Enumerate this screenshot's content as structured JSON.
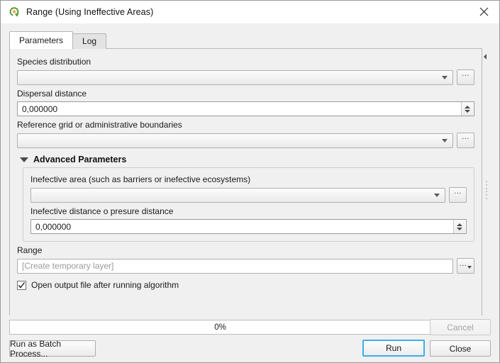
{
  "window": {
    "title": "Range (Using Ineffective Areas)",
    "app_icon": "qgis-q-icon",
    "close_icon": "close-icon"
  },
  "tabs": [
    {
      "label": "Parameters",
      "active": true
    },
    {
      "label": "Log",
      "active": false
    }
  ],
  "panel": {
    "collapse_icon": "chevron-left-icon",
    "splitter_icon": "splitter-handle-icon"
  },
  "parameters": {
    "species_distribution": {
      "label": "Species distribution",
      "value": "",
      "browse_label": "...",
      "dropdown_icon": "chevron-down-icon"
    },
    "dispersal_distance": {
      "label": "Dispersal distance",
      "value": "0,000000",
      "spinner_icon": "spinner-arrows-icon"
    },
    "reference_grid": {
      "label": "Reference grid or administrative boundaries",
      "value": "",
      "browse_label": "...",
      "dropdown_icon": "chevron-down-icon"
    },
    "advanced": {
      "title": "Advanced Parameters",
      "expanded": true,
      "toggle_icon": "triangle-down-icon",
      "inefective_area": {
        "label": "Inefective area (such as barriers or inefective ecosystems)",
        "value": "",
        "browse_label": "...",
        "dropdown_icon": "chevron-down-icon"
      },
      "inefective_distance": {
        "label": "Inefective distance o presure distance",
        "value": "0,000000",
        "spinner_icon": "spinner-arrows-icon"
      }
    },
    "range_output": {
      "label": "Range",
      "placeholder": "[Create temporary layer]",
      "value": "",
      "browse_label": "...",
      "browse_caret_icon": "caret-down-icon"
    },
    "open_output": {
      "label": "Open output file after running algorithm",
      "checked": true,
      "check_icon": "checkmark-icon"
    }
  },
  "footer": {
    "progress_text": "0%",
    "progress_percent": 0,
    "cancel_label": "Cancel",
    "cancel_enabled": false,
    "batch_label": "Run as Batch Process...",
    "run_label": "Run",
    "close_label": "Close"
  },
  "colors": {
    "accent": "#3daee9",
    "qgis_green": "#589632",
    "window_bg": "#f0f0f0",
    "titlebar_bg": "#ffffff",
    "field_bg": "#ffffff"
  }
}
